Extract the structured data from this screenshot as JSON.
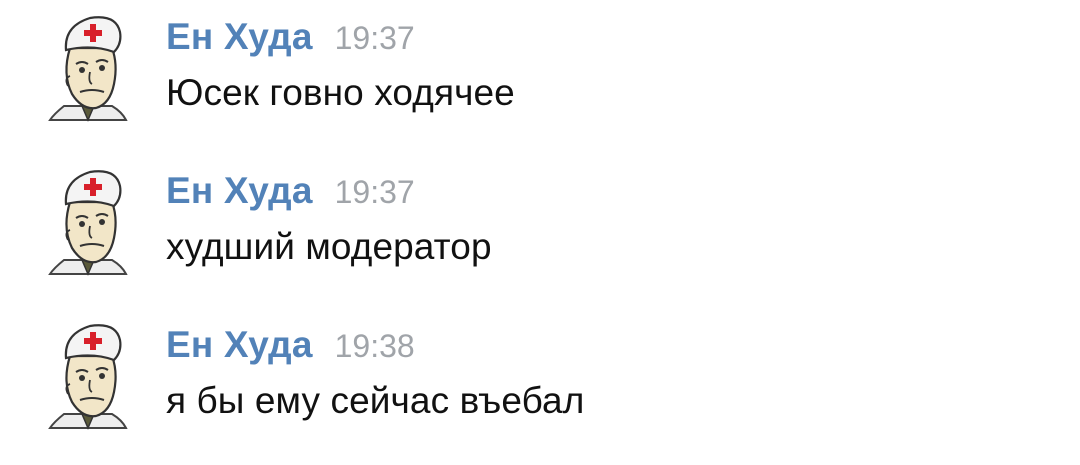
{
  "messages": [
    {
      "author": "Ен Худа",
      "time": "19:37",
      "text": "Юсек говно ходячее",
      "avatar_icon": "doctor-avatar-icon"
    },
    {
      "author": "Ен Худа",
      "time": "19:37",
      "text": "худший модератор",
      "avatar_icon": "doctor-avatar-icon"
    },
    {
      "author": "Ен Худа",
      "time": "19:38",
      "text": "я бы ему сейчас въебал",
      "avatar_icon": "doctor-avatar-icon"
    }
  ],
  "colors": {
    "author": "#5282b8",
    "time": "#a0a4a9",
    "text": "#111111",
    "cross": "#d8202a"
  }
}
